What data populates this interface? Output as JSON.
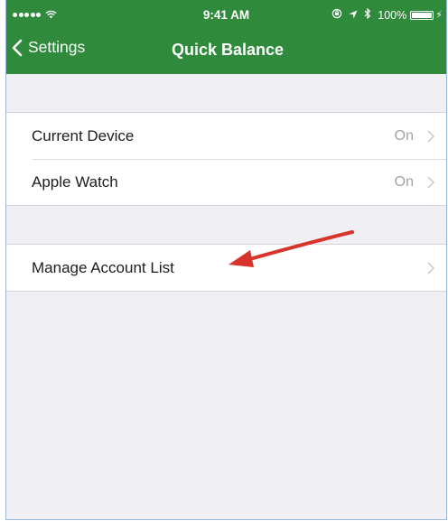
{
  "status_bar": {
    "time": "9:41 AM",
    "battery": "100%",
    "battery_level": 1.0,
    "icons": [
      "signal-dots",
      "wifi-icon",
      "location-icon",
      "bluetooth-icon",
      "battery-icon",
      "charging-bolt-icon"
    ]
  },
  "nav": {
    "back_label": "Settings",
    "title": "Quick Balance"
  },
  "groups": [
    {
      "rows": [
        {
          "label": "Current Device",
          "value": "On"
        },
        {
          "label": "Apple Watch",
          "value": "On"
        }
      ]
    },
    {
      "rows": [
        {
          "label": "Manage Account List",
          "value": ""
        }
      ]
    }
  ],
  "colors": {
    "nav_green": "#2f8a3c",
    "annotation_arrow": "#d9342b",
    "secondary_text": "#a2a2a6",
    "background": "#efeff4"
  }
}
